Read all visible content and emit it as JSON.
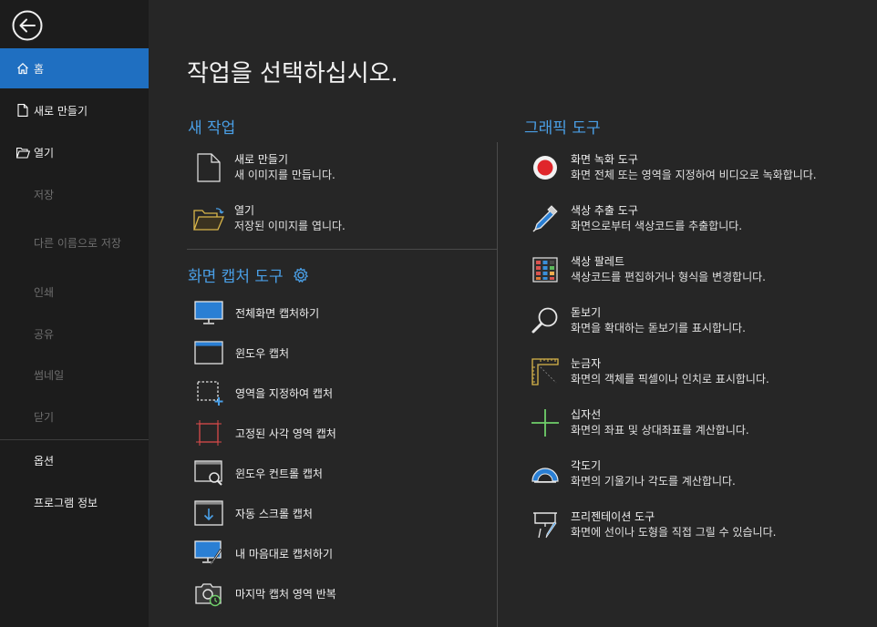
{
  "sidebar": {
    "items": [
      {
        "label": "홈",
        "icon": "home-icon",
        "active": true
      },
      {
        "label": "새로 만들기",
        "icon": "new-file-icon"
      },
      {
        "label": "열기",
        "icon": "open-folder-icon"
      },
      {
        "label": "저장",
        "disabled": true
      },
      {
        "label": "다른 이름으로 저장",
        "disabled": true
      },
      {
        "label": "인쇄",
        "disabled": true
      },
      {
        "label": "공유",
        "disabled": true
      },
      {
        "label": "썸네일",
        "disabled": true
      },
      {
        "label": "닫기",
        "disabled": true
      },
      {
        "label": "옵션"
      },
      {
        "label": "프로그램 정보"
      }
    ]
  },
  "main": {
    "title": "작업을 선택하십시오.",
    "new_task": {
      "heading": "새 작업",
      "items": [
        {
          "name": "새로 만들기",
          "desc": "새 이미지를 만듭니다.",
          "icon": "new-file-icon"
        },
        {
          "name": "열기",
          "desc": "저장된 이미지를 엽니다.",
          "icon": "open-folder-icon"
        }
      ]
    },
    "capture": {
      "heading": "화면 캡처 도구",
      "items": [
        {
          "label": "전체화면 캡처하기",
          "icon": "monitor-icon"
        },
        {
          "label": "윈도우 캡처",
          "icon": "window-icon"
        },
        {
          "label": "영역을 지정하여 캡처",
          "icon": "region-select-icon"
        },
        {
          "label": "고정된 사각 영역 캡처",
          "icon": "fixed-rect-icon"
        },
        {
          "label": "윈도우 컨트롤 캡처",
          "icon": "window-control-icon"
        },
        {
          "label": "자동 스크롤 캡처",
          "icon": "scroll-capture-icon"
        },
        {
          "label": "내 마음대로 캡처하기",
          "icon": "freehand-capture-icon"
        },
        {
          "label": "마지막 캡처 영역 반복",
          "icon": "repeat-capture-icon"
        }
      ]
    },
    "graphic": {
      "heading": "그래픽 도구",
      "items": [
        {
          "name": "화면 녹화 도구",
          "desc": "화면 전체 또는 영역을 지정하여 비디오로 녹화합니다.",
          "icon": "record-icon"
        },
        {
          "name": "색상 추출 도구",
          "desc": "화면으로부터 색상코드를 추출합니다.",
          "icon": "eyedropper-icon"
        },
        {
          "name": "색상 팔레트",
          "desc": "색상코드를 편집하거나 형식을 변경합니다.",
          "icon": "palette-icon"
        },
        {
          "name": "돋보기",
          "desc": "화면을 확대하는 돋보기를 표시합니다.",
          "icon": "magnifier-icon"
        },
        {
          "name": "눈금자",
          "desc": "화면의 객체를 픽셀이나 인치로 표시합니다.",
          "icon": "ruler-icon"
        },
        {
          "name": "십자선",
          "desc": "화면의 좌표 및 상대좌표를 계산합니다.",
          "icon": "crosshair-icon"
        },
        {
          "name": "각도기",
          "desc": "화면의 기울기나 각도를 계산합니다.",
          "icon": "protractor-icon"
        },
        {
          "name": "프리젠테이션 도구",
          "desc": "화면에 선이나 도형을 직접 그릴 수 있습니다.",
          "icon": "presentation-icon"
        }
      ]
    }
  }
}
